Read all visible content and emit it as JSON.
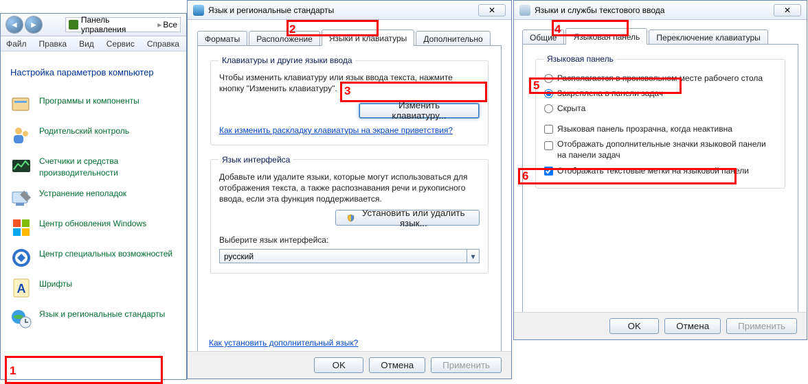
{
  "cp": {
    "crumb_root": "Панель управления",
    "crumb_leaf": "Все",
    "menu": {
      "file": "Файл",
      "edit": "Правка",
      "view": "Вид",
      "tools": "Сервис",
      "help": "Справка"
    },
    "heading": "Настройка параметров компьютер",
    "cats": [
      "Программы и компоненты",
      "Родительский контроль",
      "Счетчики и средства производительности",
      "Устранение неполадок",
      "Центр обновления Windows",
      "Центр специальных возможностей",
      "Шрифты",
      "Язык и региональные стандарты"
    ]
  },
  "dlg1": {
    "title": "Язык и региональные стандарты",
    "tabs": {
      "t0": "Форматы",
      "t1": "Расположение",
      "t2": "Языки и клавиатуры",
      "t3": "Дополнительно"
    },
    "grp1": {
      "legend": "Клавиатуры и другие языки ввода",
      "text": "Чтобы изменить клавиатуру или язык ввода текста, нажмите кнопку \"Изменить клавиатуру\".",
      "btn": "Изменить клавиатуру...",
      "link": "Как изменить раскладку клавиатуры на экране приветствия?"
    },
    "grp2": {
      "legend": "Язык интерфейса",
      "text": "Добавьте или удалите языки, которые могут использоваться для отображения текста, а также распознавания речи и рукописного ввода, если эта функция поддерживается.",
      "btn": "Установить или удалить язык...",
      "label": "Выберите язык интерфейса:",
      "value": "русский"
    },
    "link2": "Как установить дополнительный язык?",
    "footer": {
      "ok": "OK",
      "cancel": "Отмена",
      "apply": "Применить"
    }
  },
  "dlg2": {
    "title": "Языки и службы текстового ввода",
    "tabs": {
      "t0": "Общие",
      "t1": "Языковая панель",
      "t2": "Переключение клавиатуры"
    },
    "grp": {
      "legend": "Языковая панель",
      "r0": "Располагается в произвольном месте рабочего стола",
      "r1": "Закреплена в панели задач",
      "r2": "Скрыта",
      "c0": "Языковая панель прозрачна, когда неактивна",
      "c1": "Отображать дополнительные значки языковой панели на панели задач",
      "c2": "Отображать текстовые метки на языковой панели"
    },
    "footer": {
      "ok": "OK",
      "cancel": "Отмена",
      "apply": "Применить"
    }
  },
  "markers": {
    "n1": "1",
    "n2": "2",
    "n3": "3",
    "n4": "4",
    "n5": "5",
    "n6": "6"
  }
}
